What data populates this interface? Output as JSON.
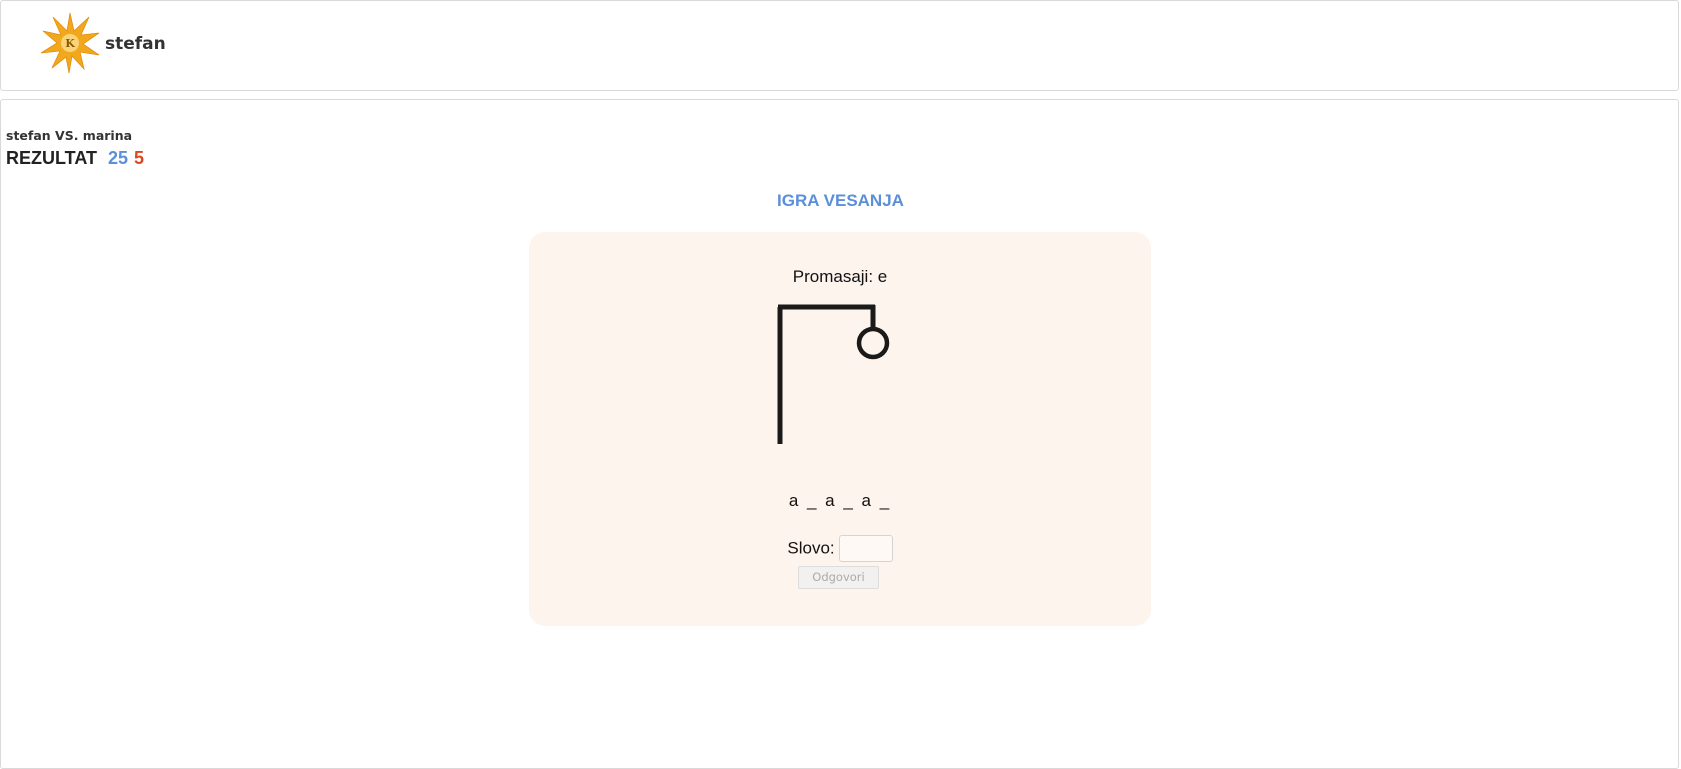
{
  "header": {
    "username": "stefan",
    "logo_letter": "K"
  },
  "match": {
    "players": "stefan VS. marina",
    "score_label": "REZULTAT",
    "score_player1": "25",
    "score_player2": "5"
  },
  "game": {
    "title": "IGRA VESANJA",
    "misses_text": "Promasaji: e",
    "word_pattern": "a _ a _ a _",
    "letter_label": "Slovo:",
    "letter_value": "",
    "submit_label": "Odgovori",
    "wrong_guess_count": 1
  },
  "colors": {
    "accent_blue": "#5b8fd9",
    "score_red": "#e0461e",
    "card_background": "#fef4ee",
    "logo_orange": "#f2a81d"
  }
}
